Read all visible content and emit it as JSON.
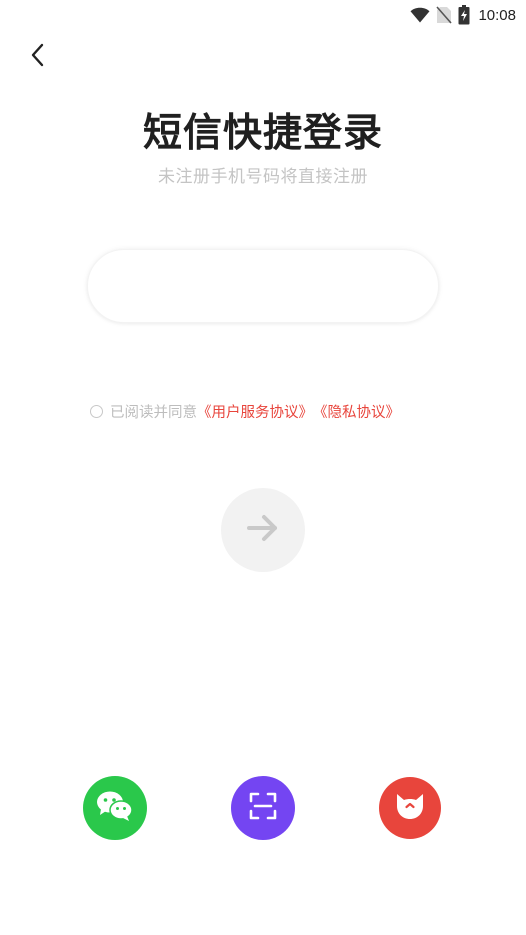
{
  "status_bar": {
    "time": "10:08",
    "icons": [
      "wifi-icon",
      "no-sim-icon",
      "battery-charging-icon"
    ]
  },
  "back": {
    "icon": "chevron-left-icon"
  },
  "header": {
    "title": "短信快捷登录",
    "subtitle": "未注册手机号码将直接注册"
  },
  "phone_input": {
    "value": "",
    "placeholder": ""
  },
  "agreement": {
    "checked": false,
    "prefix": "已阅读并同意",
    "service_link": "《用户服务协议》",
    "privacy_link": "《隐私协议》"
  },
  "next_button": {
    "icon": "arrow-right-icon",
    "enabled": false
  },
  "alt_login": [
    {
      "name": "wechat",
      "icon": "wechat-icon",
      "color": "#2ac84b"
    },
    {
      "name": "scan",
      "icon": "scan-icon",
      "color": "#7445f2"
    },
    {
      "name": "cat",
      "icon": "cat-face-icon",
      "color": "#e8453c"
    }
  ],
  "colors": {
    "accent_red": "#e8453c",
    "muted_text": "#c4c4c4",
    "title_text": "#202020"
  }
}
